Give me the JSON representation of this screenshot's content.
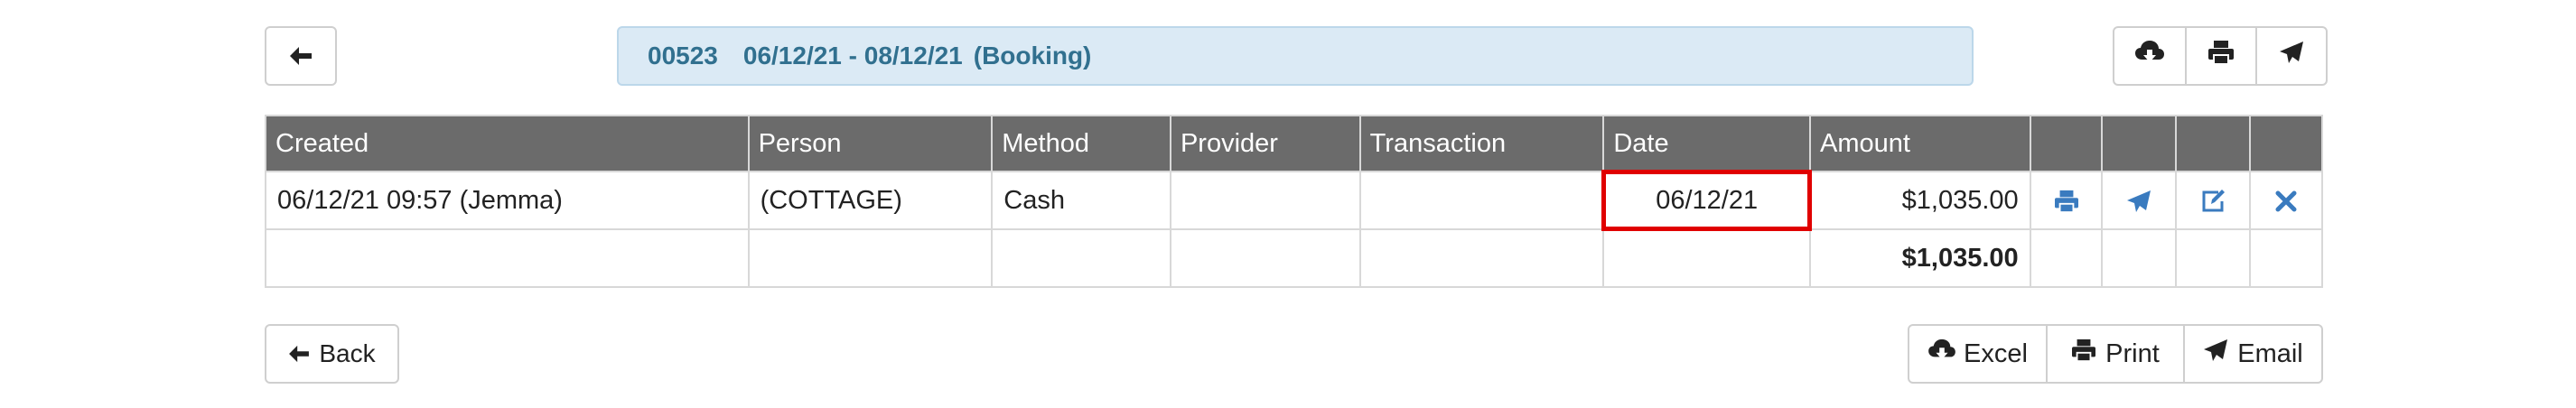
{
  "header": {
    "booking_ref": "00523",
    "date_range": "06/12/21 - 08/12/21",
    "booking_type": "(Booking)"
  },
  "table": {
    "columns": [
      "Created",
      "Person",
      "Method",
      "Provider",
      "Transaction",
      "Date",
      "Amount",
      "",
      "",
      "",
      ""
    ],
    "rows": [
      {
        "created": "06/12/21 09:57 (Jemma)",
        "person": "(COTTAGE)",
        "method": "Cash",
        "provider": "",
        "transaction": "",
        "date": "06/12/21",
        "amount": "$1,035.00"
      }
    ],
    "total_amount": "$1,035.00"
  },
  "footer": {
    "back_label": "Back",
    "excel_label": "Excel",
    "print_label": "Print",
    "email_label": "Email"
  },
  "colors": {
    "header_bg": "#6b6b6b",
    "info_bg": "#dbeaf5",
    "info_text": "#31708f",
    "icon_blue": "#3a7bbf",
    "highlight": "#e00000"
  }
}
